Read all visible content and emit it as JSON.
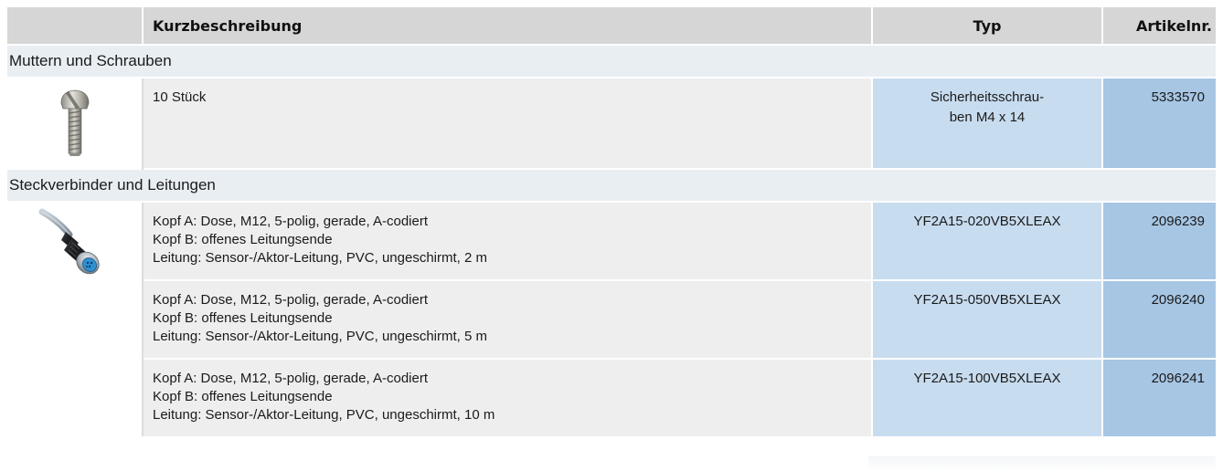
{
  "header": {
    "description": "Kurzbeschreibung",
    "type": "Typ",
    "article_number": "Artikelnr."
  },
  "groups": [
    {
      "title": "Muttern und Schrauben",
      "image_icon": "security-screw-icon",
      "rows": [
        {
          "description": [
            "10 Stück"
          ],
          "type": "Sicherheitsschrau-ben M4 x 14",
          "type_lines": [
            "Sicherheitsschrau-",
            "ben M4 x 14"
          ],
          "article": "5333570"
        }
      ]
    },
    {
      "title": "Steckverbinder und Leitungen",
      "image_icon": "m12-connector-cable-icon",
      "rows": [
        {
          "description": [
            "Kopf A: Dose, M12, 5-polig, gerade, A-codiert",
            "Kopf B: offenes Leitungsende",
            "Leitung: Sensor-/Aktor-Leitung, PVC, ungeschirmt, 2 m"
          ],
          "type": "YF2A15-020VB5XLEAX",
          "article": "2096239"
        },
        {
          "description": [
            "Kopf A: Dose, M12, 5-polig, gerade, A-codiert",
            "Kopf B: offenes Leitungsende",
            "Leitung: Sensor-/Aktor-Leitung, PVC, ungeschirmt, 5 m"
          ],
          "type": "YF2A15-050VB5XLEAX",
          "article": "2096240"
        },
        {
          "description": [
            "Kopf A: Dose, M12, 5-polig, gerade, A-codiert",
            "Kopf B: offenes Leitungsende",
            "Leitung: Sensor-/Aktor-Leitung, PVC, ungeschirmt, 10 m"
          ],
          "type": "YF2A15-100VB5XLEAX",
          "article": "2096241"
        }
      ]
    }
  ],
  "colors": {
    "header_bg": "#d6d6d6",
    "group_bg": "#e9eef3",
    "description_bg": "#eeeeee",
    "type_bg": "#c8dcef",
    "article_bg": "#a6c6e4"
  }
}
